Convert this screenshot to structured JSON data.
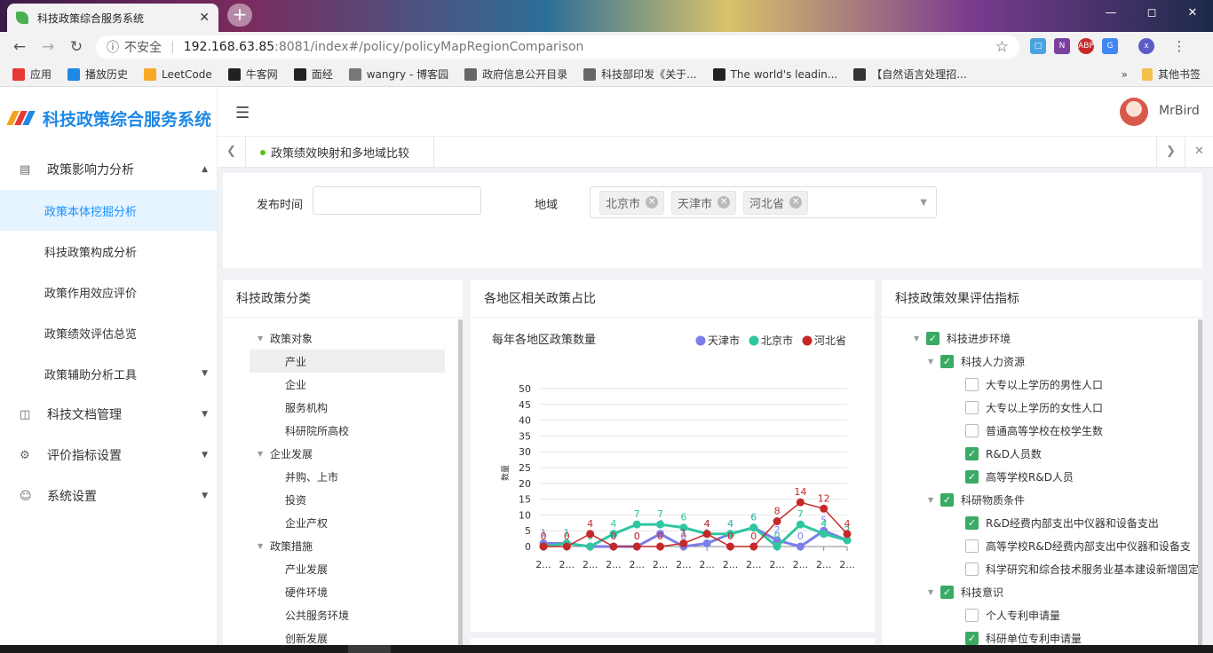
{
  "browser": {
    "tab_title": "科技政策综合服务系统",
    "tab_close": "✕",
    "new_tab": "+",
    "url_security": "不安全",
    "url_host": "192.168.63.85",
    "url_path": ":8081/index#/policy/policyMapRegionComparison"
  },
  "bookmarks": [
    {
      "label": "应用",
      "color": "#e53935"
    },
    {
      "label": "播放历史",
      "color": "#1e88e5"
    },
    {
      "label": "LeetCode",
      "color": "#f9a825"
    },
    {
      "label": "牛客网",
      "color": "#222222"
    },
    {
      "label": "面经",
      "color": "#222222"
    },
    {
      "label": "wangry - 博客园",
      "color": "#777777"
    },
    {
      "label": "政府信息公开目录",
      "color": "#666666"
    },
    {
      "label": "科技部印发《关于...",
      "color": "#666666"
    },
    {
      "label": "The world's leadin...",
      "color": "#222222"
    },
    {
      "label": "【自然语言处理招...",
      "color": "#333333"
    }
  ],
  "bookmarks_more": "其他书签",
  "app": {
    "title": "科技政策综合服务系统",
    "username": "MrBird"
  },
  "sidebar": {
    "m1": "政策影响力分析",
    "subs": [
      "政策本体挖掘分析",
      "科技政策构成分析",
      "政策作用效应评价",
      "政策绩效评估总览",
      "政策辅助分析工具"
    ],
    "m2": "科技文档管理",
    "m3": "评价指标设置",
    "m4": "系统设置"
  },
  "tagbar": {
    "active_tag": "政策绩效映射和多地域比较"
  },
  "filter": {
    "time_label": "发布时间",
    "time_value": "",
    "region_label": "地域",
    "regions": [
      "北京市",
      "天津市",
      "河北省"
    ]
  },
  "classify": {
    "title": "科技政策分类",
    "nodes": [
      {
        "label": "政策对象",
        "level": 1
      },
      {
        "label": "产业",
        "level": 2,
        "selected": true
      },
      {
        "label": "企业",
        "level": 2
      },
      {
        "label": "服务机构",
        "level": 2
      },
      {
        "label": "科研院所高校",
        "level": 2
      },
      {
        "label": "企业发展",
        "level": 1
      },
      {
        "label": "并购、上市",
        "level": 2
      },
      {
        "label": "投资",
        "level": 2
      },
      {
        "label": "企业产权",
        "level": 2
      },
      {
        "label": "政策措施",
        "level": 1
      },
      {
        "label": "产业发展",
        "level": 2
      },
      {
        "label": "硬件环境",
        "level": 2
      },
      {
        "label": "公共服务环境",
        "level": 2
      },
      {
        "label": "创新发展",
        "level": 2
      }
    ]
  },
  "ratio_card": {
    "title": "各地区相关政策占比"
  },
  "chart_data": {
    "type": "line",
    "title": "每年各地区政策数量",
    "ylabel": "数量",
    "ylim": [
      0,
      50
    ],
    "yticks": [
      0,
      5,
      10,
      15,
      20,
      25,
      30,
      35,
      40,
      45,
      50
    ],
    "x": [
      "2...",
      "2...",
      "2...",
      "2...",
      "2...",
      "2...",
      "2...",
      "2...",
      "2...",
      "2...",
      "2...",
      "2...",
      "2...",
      "2..."
    ],
    "grid": true,
    "legend": "top-right",
    "series": [
      {
        "name": "天津市",
        "color": "#7b7ee8",
        "values": [
          1,
          1,
          0,
          0,
          0,
          4,
          0,
          1,
          4,
          6,
          2,
          0,
          5,
          2
        ]
      },
      {
        "name": "北京市",
        "color": "#2ec7a0",
        "values": [
          0,
          1,
          0,
          4,
          7,
          7,
          6,
          4,
          4,
          6,
          0,
          7,
          4,
          2
        ]
      },
      {
        "name": "河北省",
        "color": "#c62828",
        "values": [
          0,
          0,
          4,
          0,
          0,
          0,
          1,
          4,
          0,
          0,
          8,
          14,
          12,
          4
        ]
      }
    ]
  },
  "indicator": {
    "title": "科技政策效果评估指标",
    "nodes": [
      {
        "label": "科技进步环境",
        "level": 1,
        "checked": true,
        "tri": true
      },
      {
        "label": "科技人力资源",
        "level": 2,
        "checked": true,
        "tri": true
      },
      {
        "label": "大专以上学历的男性人口",
        "level": 3,
        "checked": false
      },
      {
        "label": "大专以上学历的女性人口",
        "level": 3,
        "checked": false
      },
      {
        "label": "普通高等学校在校学生数",
        "level": 3,
        "checked": false
      },
      {
        "label": "R&D人员数",
        "level": 3,
        "checked": true
      },
      {
        "label": "高等学校R&D人员",
        "level": 3,
        "checked": true
      },
      {
        "label": "科研物质条件",
        "level": 2,
        "checked": true,
        "tri": true
      },
      {
        "label": "R&D经费内部支出中仪器和设备支出",
        "level": 3,
        "checked": true
      },
      {
        "label": "高等学校R&D经费内部支出中仪器和设备支",
        "level": 3,
        "checked": false
      },
      {
        "label": "科学研究和综合技术服务业基本建设新增固定",
        "level": 3,
        "checked": false
      },
      {
        "label": "科技意识",
        "level": 2,
        "checked": true,
        "tri": true
      },
      {
        "label": "个人专利申请量",
        "level": 3,
        "checked": false
      },
      {
        "label": "科研单位专利申请量",
        "level": 3,
        "checked": true
      }
    ]
  }
}
